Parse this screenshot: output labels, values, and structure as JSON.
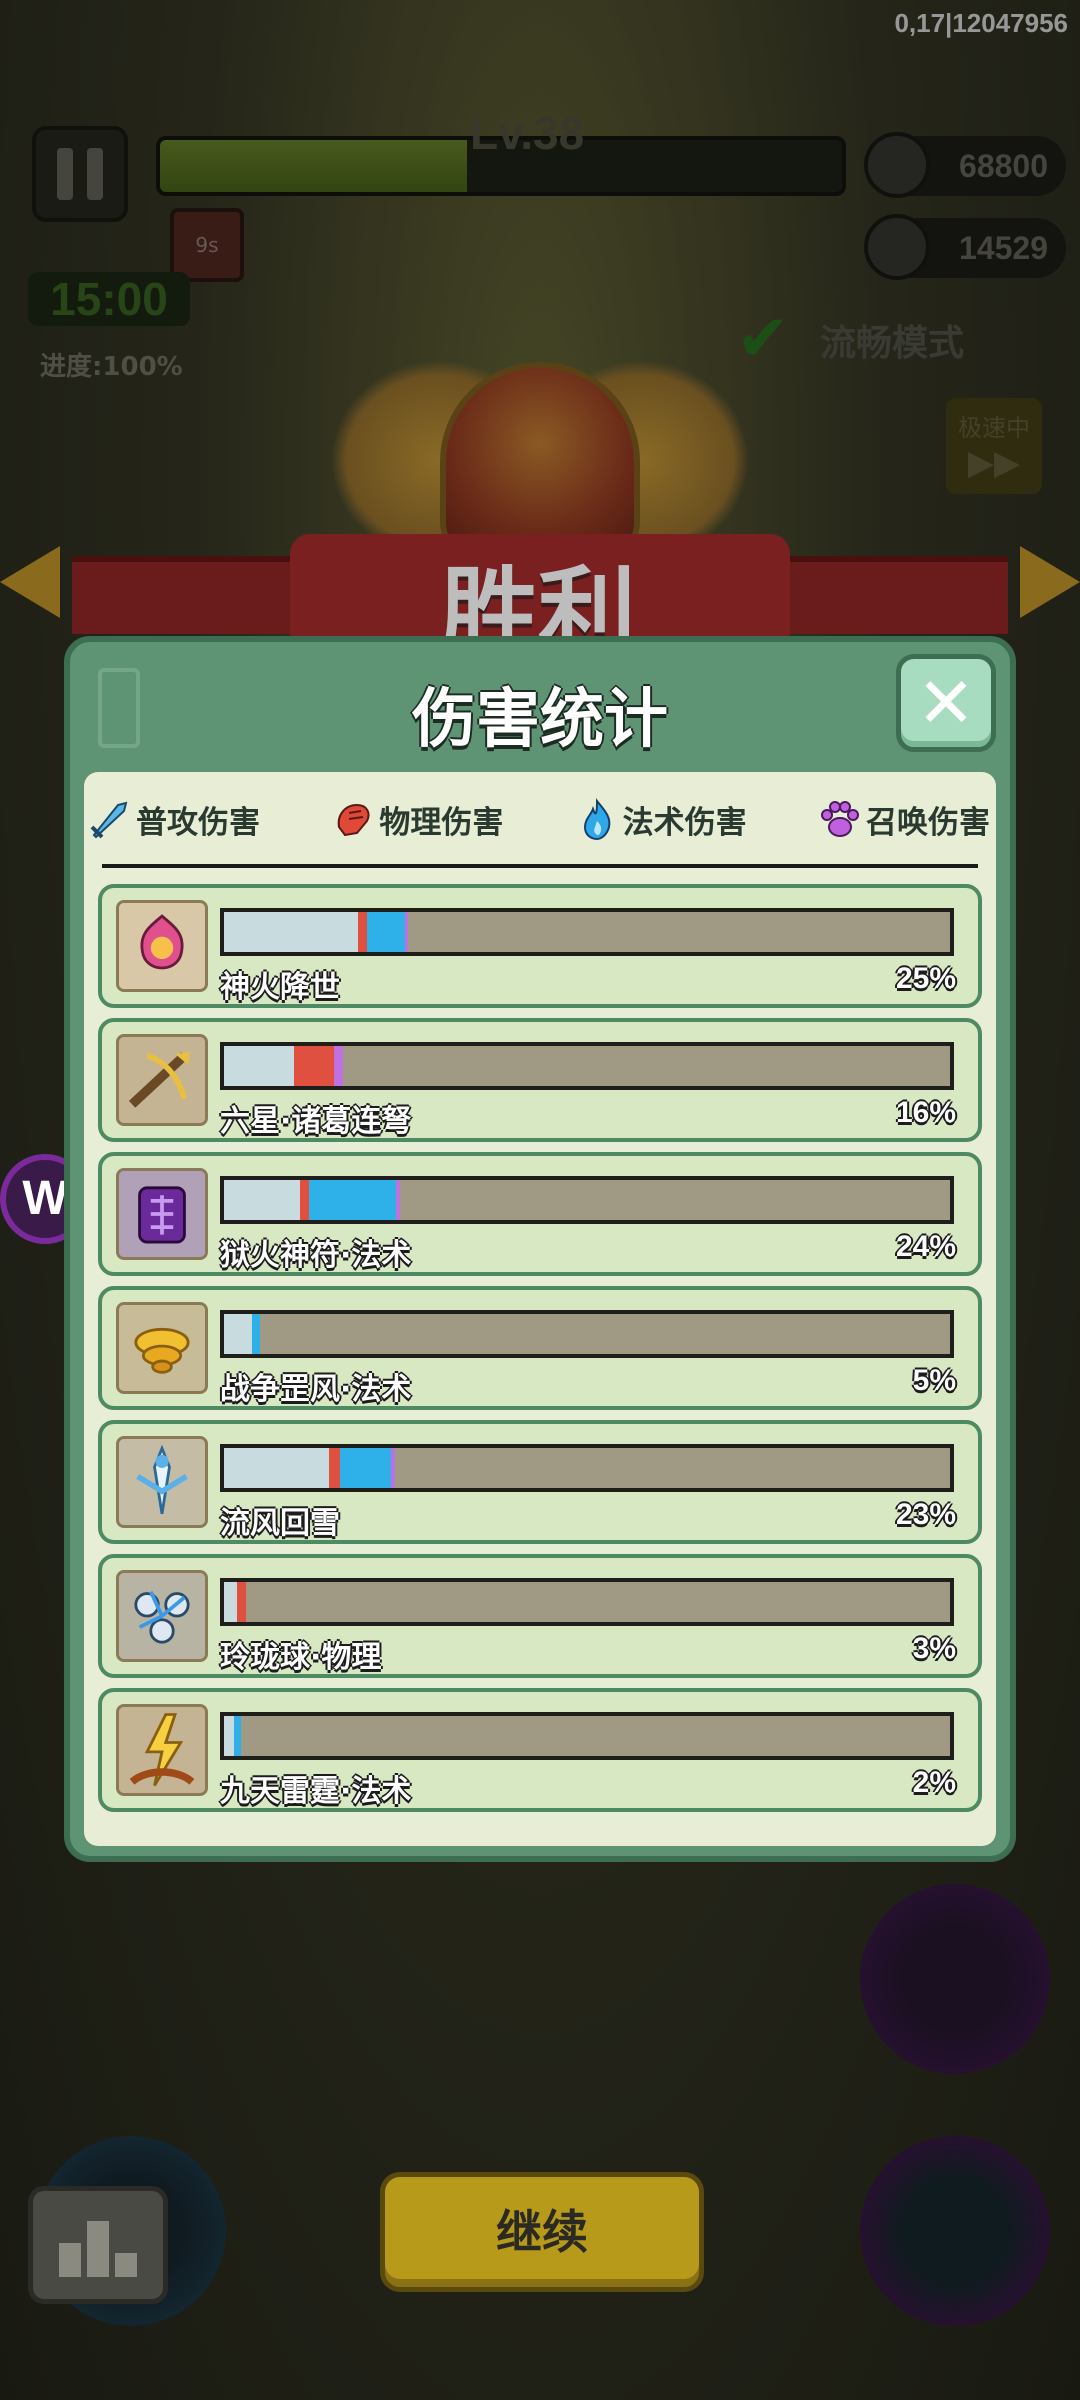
{
  "device_info": "0,17|12047956",
  "hud": {
    "level": "Lv.38",
    "level_progress": 0.45,
    "skill_cooldown": "9s",
    "timer": "15:00",
    "progress": "进度:100%",
    "coins": "68800",
    "kills": "14529",
    "smooth_mode": "流畅模式",
    "speed_label": "极速中"
  },
  "banner": {
    "victory": "胜利"
  },
  "panel": {
    "title": "伤害统计",
    "legend": [
      {
        "label": "普攻伤害",
        "icon": "sword-icon",
        "color": "#2eb0e8"
      },
      {
        "label": "物理伤害",
        "icon": "fist-icon",
        "color": "#e05040"
      },
      {
        "label": "法术伤害",
        "icon": "flame-icon",
        "color": "#2eb0e8"
      },
      {
        "label": "召唤伤害",
        "icon": "paw-icon",
        "color": "#c070e0"
      }
    ],
    "rows": [
      {
        "name": "神火降世",
        "percent": "25%",
        "icon": "divine-fire-icon",
        "segments": {
          "normal": 0.185,
          "physical": 0.012,
          "magic": 0.052,
          "summon": 0.005
        }
      },
      {
        "name": "六星·诸葛连弩",
        "percent": "16%",
        "icon": "crossbow-icon",
        "segments": {
          "normal": 0.096,
          "physical": 0.056,
          "magic": 0.0,
          "summon": 0.012
        }
      },
      {
        "name": "狱火神符·法术",
        "percent": "24%",
        "icon": "hellfire-talisman-icon",
        "segments": {
          "normal": 0.105,
          "physical": 0.012,
          "magic": 0.12,
          "summon": 0.005
        }
      },
      {
        "name": "战争罡风·法术",
        "percent": "5%",
        "icon": "war-wind-icon",
        "segments": {
          "normal": 0.038,
          "physical": 0.0,
          "magic": 0.012,
          "summon": 0.0
        }
      },
      {
        "name": "流风回雪",
        "percent": "23%",
        "icon": "wind-snow-icon",
        "segments": {
          "normal": 0.145,
          "physical": 0.015,
          "magic": 0.07,
          "summon": 0.005
        }
      },
      {
        "name": "玲珑球·物理",
        "percent": "3%",
        "icon": "linglong-ball-icon",
        "segments": {
          "normal": 0.018,
          "physical": 0.012,
          "magic": 0.0,
          "summon": 0.0
        }
      },
      {
        "name": "九天雷霆·法术",
        "percent": "2%",
        "icon": "thunder-icon",
        "segments": {
          "normal": 0.014,
          "physical": 0.0,
          "magic": 0.01,
          "summon": 0.0
        }
      }
    ]
  },
  "continue_label": "继续"
}
